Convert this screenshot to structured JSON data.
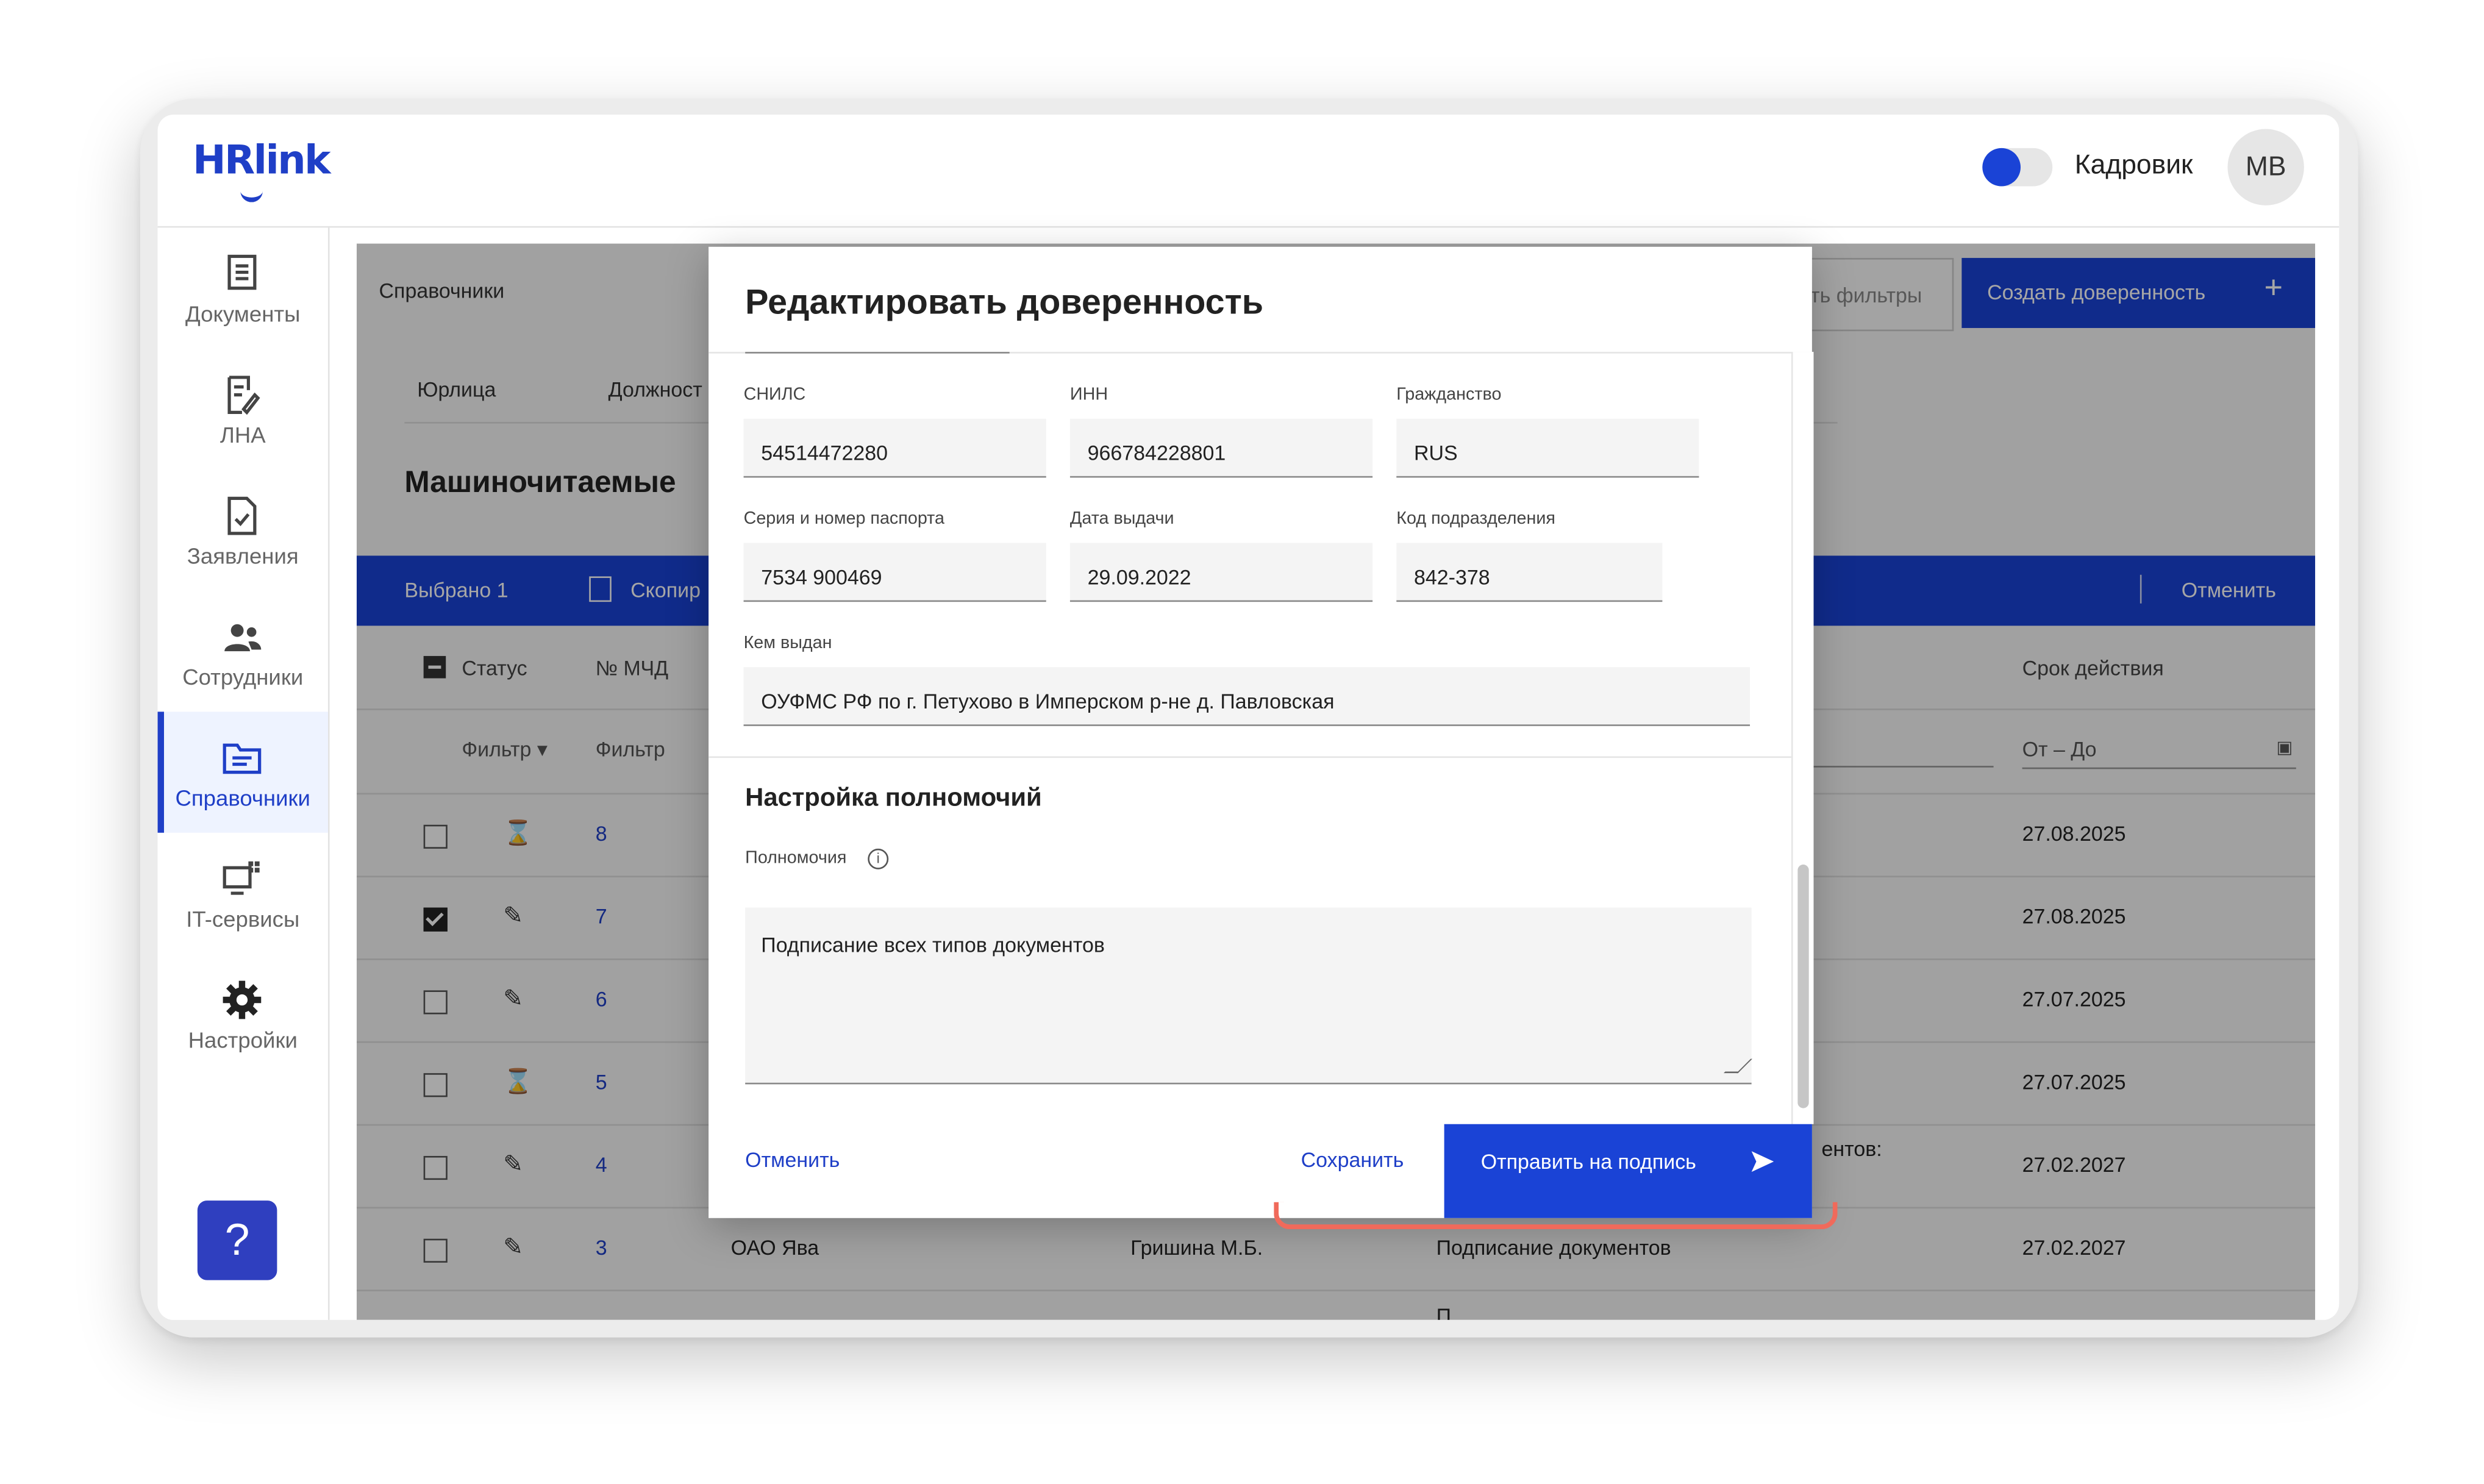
{
  "app": {
    "logo": "HRlink",
    "role_label": "Кадровик",
    "avatar": "МВ"
  },
  "sidebar": {
    "items": [
      {
        "label": "Документы",
        "icon": "documents-icon"
      },
      {
        "label": "ЛНА",
        "icon": "lna-icon"
      },
      {
        "label": "Заявления",
        "icon": "applications-icon"
      },
      {
        "label": "Сотрудники",
        "icon": "employees-icon"
      },
      {
        "label": "Справочники",
        "icon": "references-icon",
        "active": true
      },
      {
        "label": "IT-сервисы",
        "icon": "it-services-icon"
      },
      {
        "label": "Настройки",
        "icon": "settings-icon"
      }
    ],
    "help_label": "?"
  },
  "page": {
    "breadcrumb": "Справочники",
    "reset_filters": "ть фильтры",
    "create_button": "Создать доверенность",
    "tabs": [
      "Юрлица",
      "Должност"
    ],
    "title": "Машиночитаемые",
    "selection": {
      "selected": "Выбрано 1",
      "copy": "Скопир",
      "cancel": "Отменить"
    },
    "columns": {
      "status": "Статус",
      "number": "№ МЧД",
      "validity": "Срок действия"
    },
    "filters": {
      "status_filter": "Фильтр",
      "number_filter": "Фильтр",
      "date_range": "От – До"
    },
    "fragment_text": "ентов:",
    "fragment_text_2": "П",
    "rows": [
      {
        "num": "8",
        "status": "hourglass",
        "date": "27.08.2025",
        "checked": false
      },
      {
        "num": "7",
        "status": "edit",
        "date": "27.08.2025",
        "checked": true
      },
      {
        "num": "6",
        "status": "edit",
        "date": "27.07.2025",
        "checked": false
      },
      {
        "num": "5",
        "status": "hourglass",
        "date": "27.07.2025",
        "checked": false
      },
      {
        "num": "4",
        "status": "edit",
        "date": "27.02.2027",
        "checked": false
      },
      {
        "num": "3",
        "status": "edit",
        "date": "27.02.2027",
        "checked": false,
        "org": "ОАО Ява",
        "employee": "Гришина М.Б.",
        "powers": "Подписание документов"
      }
    ]
  },
  "modal": {
    "title": "Редактировать доверенность",
    "fields": {
      "snils": {
        "label": "СНИЛС",
        "value": "54514472280"
      },
      "inn": {
        "label": "ИНН",
        "value": "966784228801"
      },
      "citizenship": {
        "label": "Гражданство",
        "value": "RUS"
      },
      "passport": {
        "label": "Серия и номер паспорта",
        "value": "7534 900469"
      },
      "issue_date": {
        "label": "Дата выдачи",
        "value": "29.09.2022"
      },
      "dept_code": {
        "label": "Код подразделения",
        "value": "842-378"
      },
      "issued_by": {
        "label": "Кем выдан",
        "value": "ОУФМС РФ по г. Петухово в Имперском р-не д. Павловская"
      }
    },
    "powers_section": "Настройка полномочий",
    "powers_label": "Полномочия",
    "powers_value": "Подписание всех типов документов",
    "cancel": "Отменить",
    "save": "Сохранить",
    "send": "Отправить на подпись"
  },
  "colors": {
    "accent": "#1a43d6",
    "highlight": "#f06a5b"
  }
}
